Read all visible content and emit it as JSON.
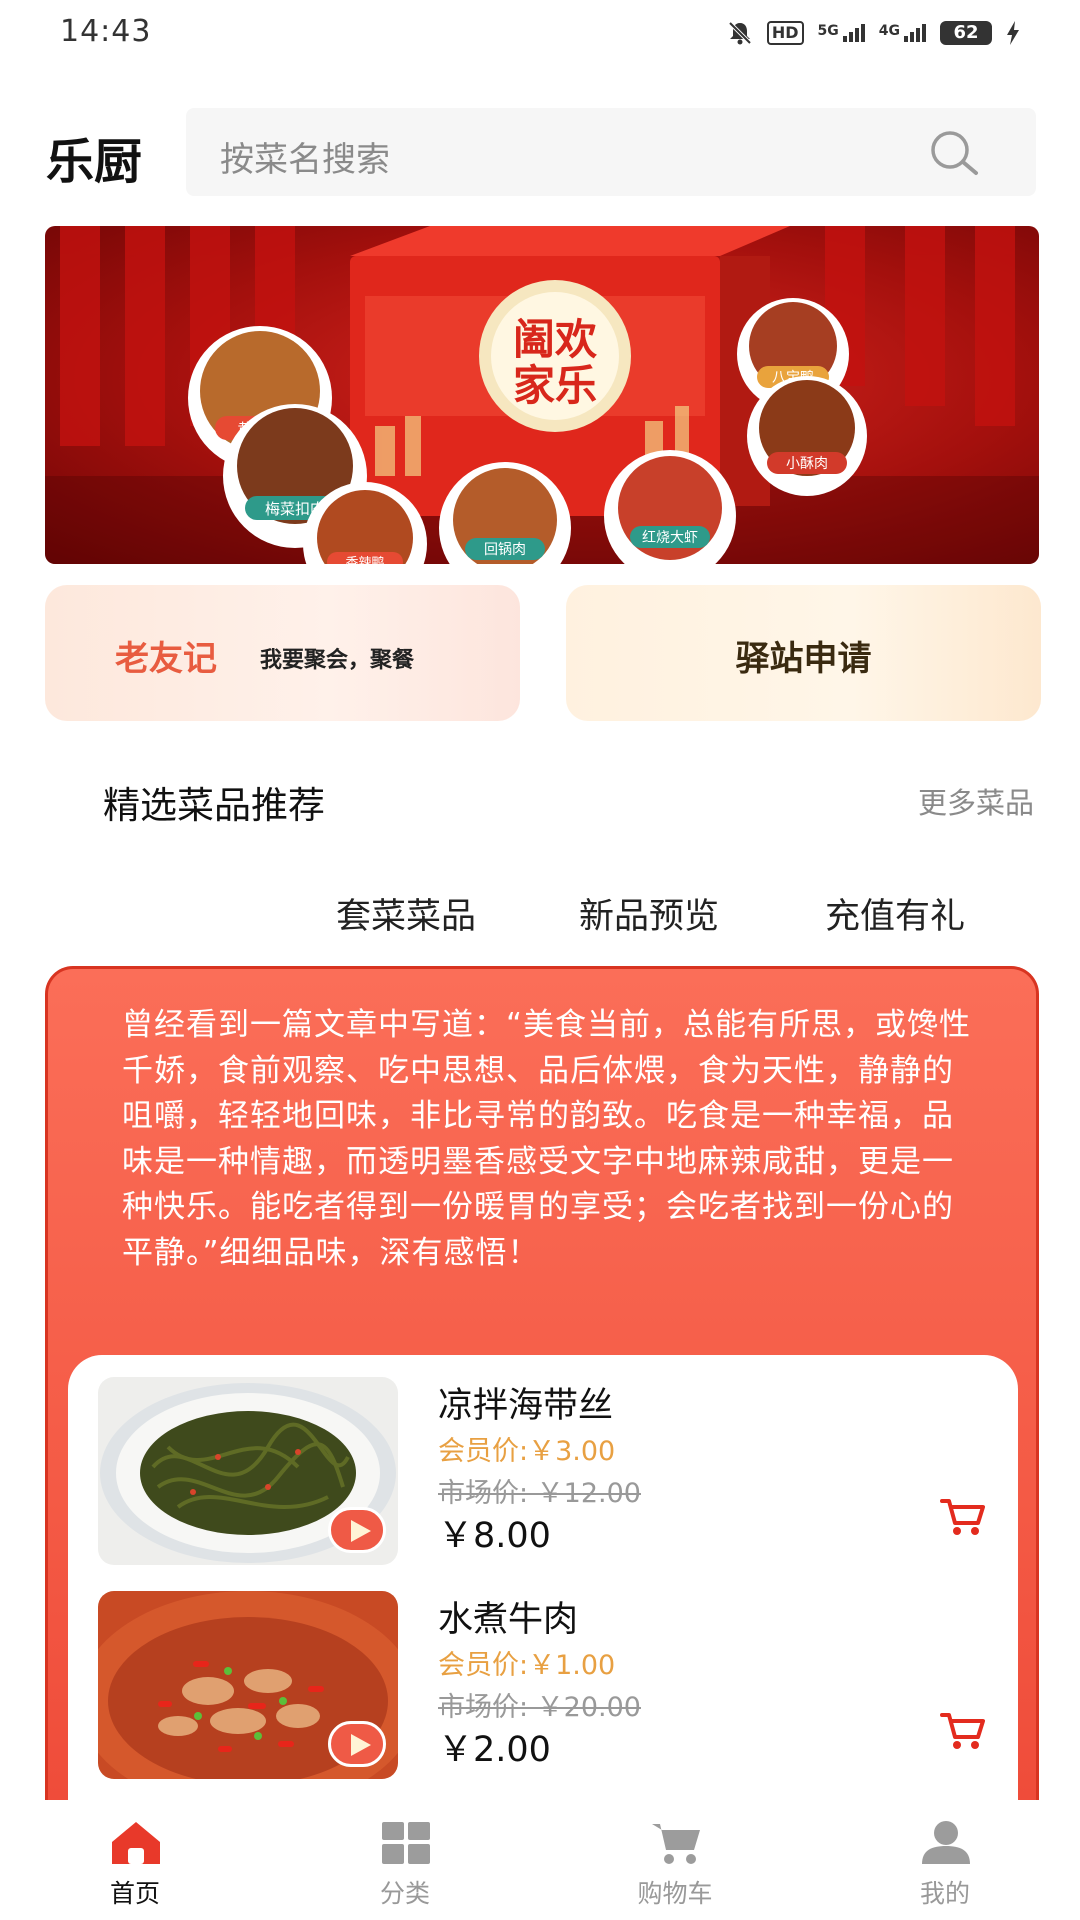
{
  "status_bar": {
    "time": "14:43",
    "hd_label": "HD",
    "net1_label": "5G",
    "net2_label": "4G",
    "battery": "62"
  },
  "header": {
    "app_title": "乐厨",
    "search_placeholder": "按菜名搜索",
    "search_icon": "search-icon"
  },
  "banner": {
    "box_text_1": "阖欢",
    "box_text_2": "家乐",
    "bowl_labels": [
      "黄焖鸡",
      "梅菜扣肉",
      "八宝鸭",
      "小酥肉",
      "红烧大虾",
      "回锅肉",
      "香辣鸭"
    ]
  },
  "quick_actions": {
    "left_title": "老友记",
    "left_subtitle": "我要聚会，聚餐",
    "right_title": "驿站申请"
  },
  "section": {
    "title": "精选菜品推荐",
    "more": "更多菜品",
    "tabs": [
      "套菜菜品",
      "新品预览",
      "充值有礼"
    ]
  },
  "quote": "曾经看到一篇文章中写道：“美食当前，总能有所思，或馋性千娇，食前观察、吃中思想、品后体煨，食为天性，静静的咀嚼，轻轻地回味，非比寻常的韵致。吃食是一种幸福，品味是一种情趣，而透明墨香感受文字中地麻辣咸甜，更是一种快乐。能吃者得到一份暖胃的享受；会吃者找到一份心的平静。”细细品味，深有感悟！",
  "products": [
    {
      "name": "凉拌海带丝",
      "member_price": "会员价:￥3.00",
      "market_price": "市场价: ￥12.00",
      "price": "￥8.00"
    },
    {
      "name": "水煮牛肉",
      "member_price": "会员价:￥1.00",
      "market_price": "市场价: ￥20.00",
      "price": "￥2.00"
    }
  ],
  "bottom_nav": [
    {
      "label": "首页",
      "icon": "home-icon",
      "active": true
    },
    {
      "label": "分类",
      "icon": "grid-icon",
      "active": false
    },
    {
      "label": "购物车",
      "icon": "cart-icon",
      "active": false
    },
    {
      "label": "我的",
      "icon": "user-icon",
      "active": false
    }
  ],
  "colors": {
    "accent": "#f45a45",
    "member_price": "#e8a042",
    "nav_active": "#e8392a"
  }
}
